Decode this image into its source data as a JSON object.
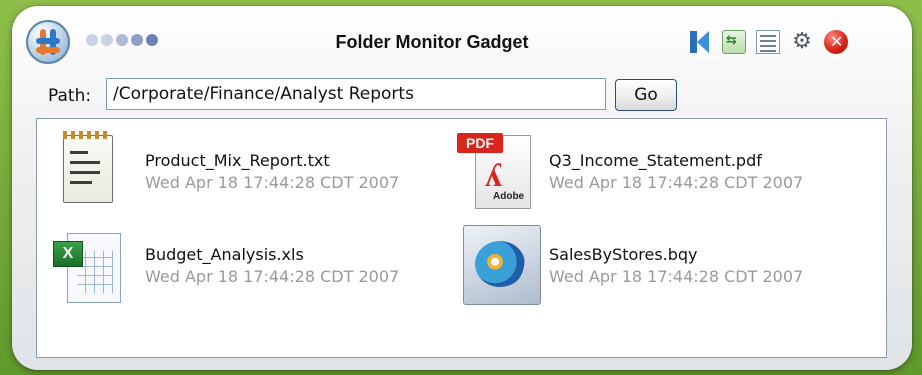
{
  "window": {
    "title": "Folder Monitor Gadget"
  },
  "toolbar": {
    "icons": [
      "k-logo-icon",
      "refresh-icon",
      "list-view-icon",
      "settings-gear-icon",
      "close-icon"
    ],
    "close_color": "#d7261c"
  },
  "path": {
    "label": "Path:",
    "value": "/Corporate/Finance/Analyst Reports",
    "go_label": "Go"
  },
  "files": [
    {
      "name": "Product_Mix_Report.txt",
      "date": "Wed Apr 18 17:44:28 CDT 2007",
      "icon": "text-file-icon"
    },
    {
      "name": "Q3_Income_Statement.pdf",
      "date": "Wed Apr 18 17:44:28 CDT 2007",
      "icon": "pdf-file-icon",
      "badge": "PDF",
      "brand": "Adobe"
    },
    {
      "name": "Budget_Analysis.xls",
      "date": "Wed Apr 18 17:44:28 CDT 2007",
      "icon": "excel-file-icon"
    },
    {
      "name": "SalesByStores.bqy",
      "date": "Wed Apr 18 17:44:28 CDT 2007",
      "icon": "bqy-file-icon"
    }
  ],
  "colors": {
    "background": "#6ea935",
    "panel_border": "#8a9bb0",
    "date_text": "#9a9a9a"
  }
}
